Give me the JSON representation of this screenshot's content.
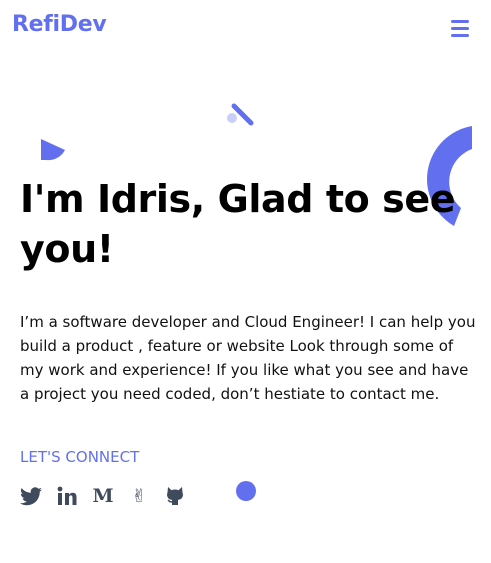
{
  "brand": {
    "name": "RefiDev"
  },
  "header": {
    "menu_icon": "hamburger-menu-icon"
  },
  "hero": {
    "title": "I'm Idris, Glad to see you!",
    "description": "I’m a software developer and Cloud Engineer! I can help you build a product , feature or website Look through some of my work and experience! If you like what you see and have a project you need coded, don’t hestiate to contact me.",
    "cta_label": "LET'S CONNECT"
  },
  "socials": [
    {
      "icon": "twitter-icon"
    },
    {
      "icon": "linkedin-icon"
    },
    {
      "icon": "medium-icon",
      "glyph": "M"
    },
    {
      "icon": "peace-hand-icon",
      "glyph": "✌"
    },
    {
      "icon": "github-icon"
    }
  ],
  "colors": {
    "accent": "#6270f0",
    "accent_light": "#c9cffa",
    "icon_gray": "#3f4a5c",
    "text": "#111111"
  }
}
